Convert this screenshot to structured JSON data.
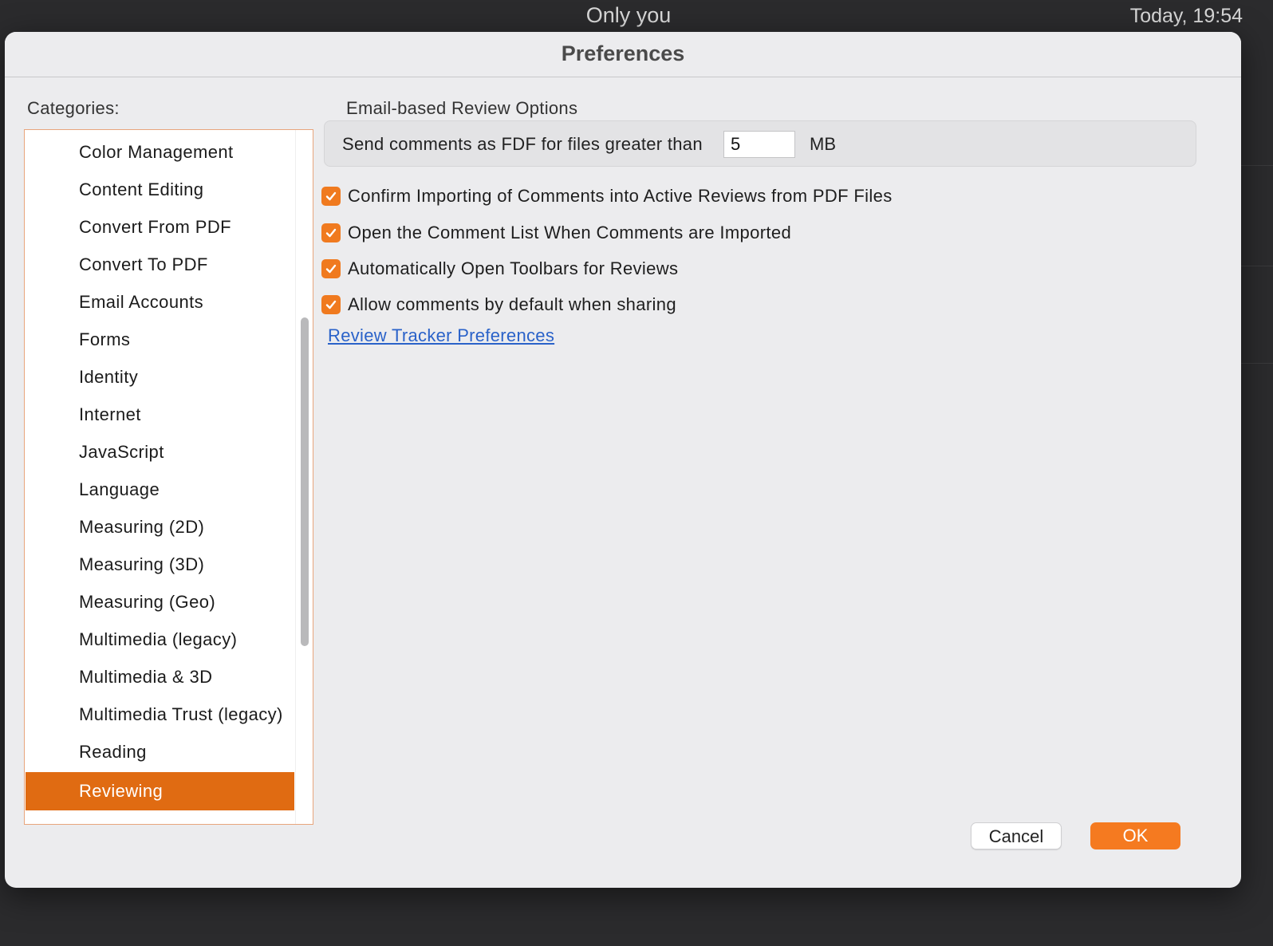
{
  "window": {
    "top_title": "Only you",
    "top_time": "Today, 19:54"
  },
  "dialog": {
    "title": "Preferences",
    "categories_label": "Categories:",
    "categories": [
      {
        "label": "Color Management",
        "selected": false
      },
      {
        "label": "Content Editing",
        "selected": false
      },
      {
        "label": "Convert From PDF",
        "selected": false
      },
      {
        "label": "Convert To PDF",
        "selected": false
      },
      {
        "label": "Email Accounts",
        "selected": false
      },
      {
        "label": "Forms",
        "selected": false
      },
      {
        "label": "Identity",
        "selected": false
      },
      {
        "label": "Internet",
        "selected": false
      },
      {
        "label": "JavaScript",
        "selected": false
      },
      {
        "label": "Language",
        "selected": false
      },
      {
        "label": "Measuring (2D)",
        "selected": false
      },
      {
        "label": "Measuring (3D)",
        "selected": false
      },
      {
        "label": "Measuring (Geo)",
        "selected": false
      },
      {
        "label": "Multimedia (legacy)",
        "selected": false
      },
      {
        "label": "Multimedia & 3D",
        "selected": false
      },
      {
        "label": "Multimedia Trust (legacy)",
        "selected": false
      },
      {
        "label": "Reading",
        "selected": false
      },
      {
        "label": "Reviewing",
        "selected": true
      }
    ],
    "review": {
      "section_title": "Email-based Review Options",
      "fdf_label": "Send comments as FDF for files greater than",
      "fdf_value": "5",
      "fdf_unit": "MB",
      "options": [
        {
          "label": "Confirm Importing of Comments into Active Reviews from PDF Files",
          "checked": true
        },
        {
          "label": "Open the Comment List When Comments are Imported",
          "checked": true
        },
        {
          "label": "Automatically Open Toolbars for Reviews",
          "checked": true
        },
        {
          "label": "Allow comments by default when sharing",
          "checked": true
        }
      ],
      "tracker_link": "Review Tracker Preferences"
    },
    "buttons": {
      "cancel": "Cancel",
      "ok": "OK"
    }
  },
  "colors": {
    "accent": "#f57a20",
    "selection": "#e06b12",
    "link": "#2a62c9"
  }
}
